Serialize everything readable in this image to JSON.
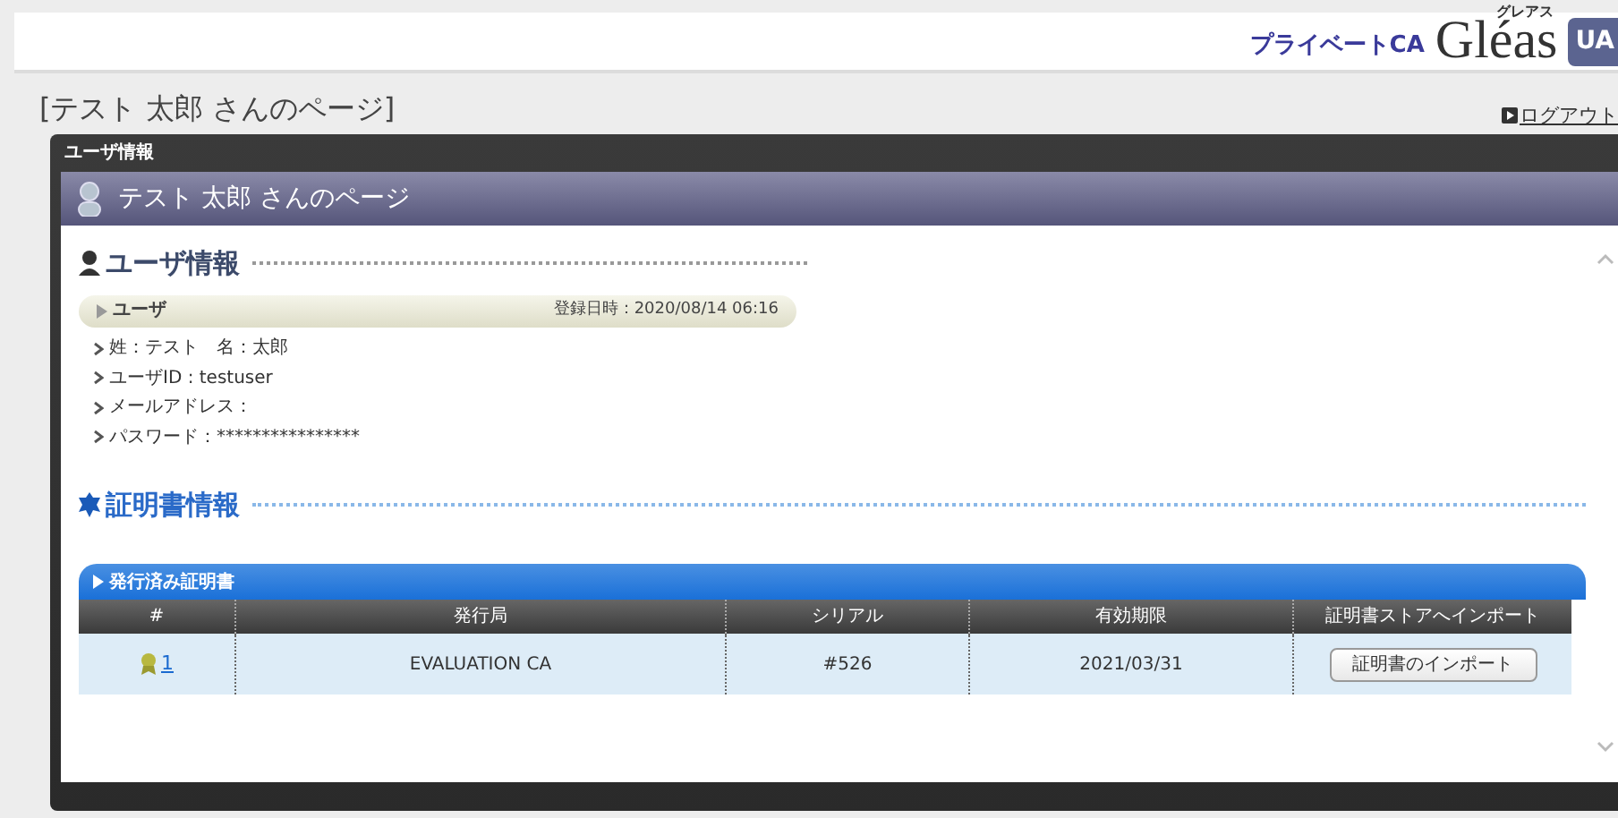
{
  "header": {
    "product_label": "プライベートCA",
    "logo": "Gléas",
    "logo_kana": "グレアス",
    "badge": "UA"
  },
  "page_title": "[テスト 太郎 さんのページ]",
  "logout": "ログアウト",
  "panel": {
    "title": "ユーザ情報",
    "banner": "テスト 太郎 さんのページ"
  },
  "user_section": {
    "heading": "ユーザ情報",
    "bar": {
      "label": "ユーザ",
      "registered": "登録日時：2020/08/14 06:16"
    },
    "fields": [
      "姓：テスト　名：太郎",
      "ユーザID : testuser",
      "メールアドレス：",
      "パスワード：****************"
    ]
  },
  "cert_section": {
    "heading": "証明書情報",
    "table": {
      "title": "発行済み証明書",
      "columns": [
        "#",
        "発行局",
        "シリアル",
        "有効期限",
        "証明書ストアへインポート"
      ],
      "rows": [
        {
          "number": "1",
          "issuer": "EVALUATION CA",
          "serial": "#526",
          "expiry": "2021/03/31",
          "action": "証明書のインポート"
        }
      ]
    }
  }
}
